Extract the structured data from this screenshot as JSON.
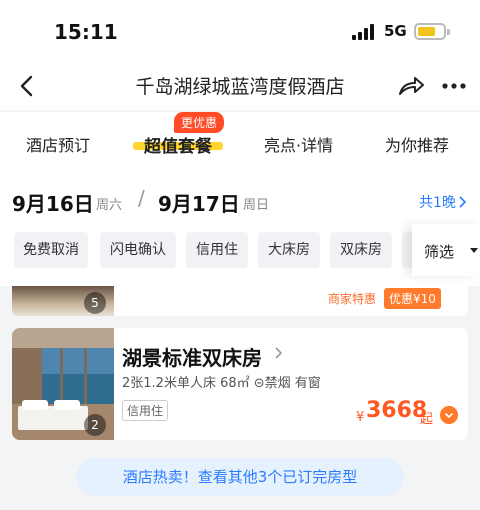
{
  "status_bar": {
    "time": "15:11",
    "network": "5G"
  },
  "nav": {
    "title": "千岛湖绿城蓝湾度假酒店"
  },
  "tabs": [
    {
      "label": "酒店预订"
    },
    {
      "label": "超值套餐",
      "badge": "更优惠",
      "active": true
    },
    {
      "label": "亮点·详情"
    },
    {
      "label": "为你推荐"
    }
  ],
  "dates": {
    "checkin": "9月16日",
    "checkin_weekday": "周六",
    "checkout": "9月17日",
    "checkout_weekday": "周日",
    "nights": "共1晚"
  },
  "filters": {
    "chips": [
      "免费取消",
      "闪电确认",
      "信用住",
      "大床房",
      "双床房"
    ],
    "filter_label": "筛选"
  },
  "previous_card": {
    "photo_count": "5",
    "merchant_label": "商家特惠",
    "promo": "优惠¥10"
  },
  "room": {
    "name": "湖景标准双床房",
    "spec": "2张1.2米单人床  68㎡  ⊝禁烟  有窗",
    "tag": "信用住",
    "photo_count": "2",
    "currency": "¥",
    "price": "3668",
    "price_suffix": "起"
  },
  "banner": {
    "text": "酒店热卖！查看其他3个已订完房型"
  },
  "colors": {
    "accent": "#ff5722",
    "link": "#2b7bff",
    "tab_highlight": "#ffd52e",
    "badge": "#ff4b26"
  }
}
